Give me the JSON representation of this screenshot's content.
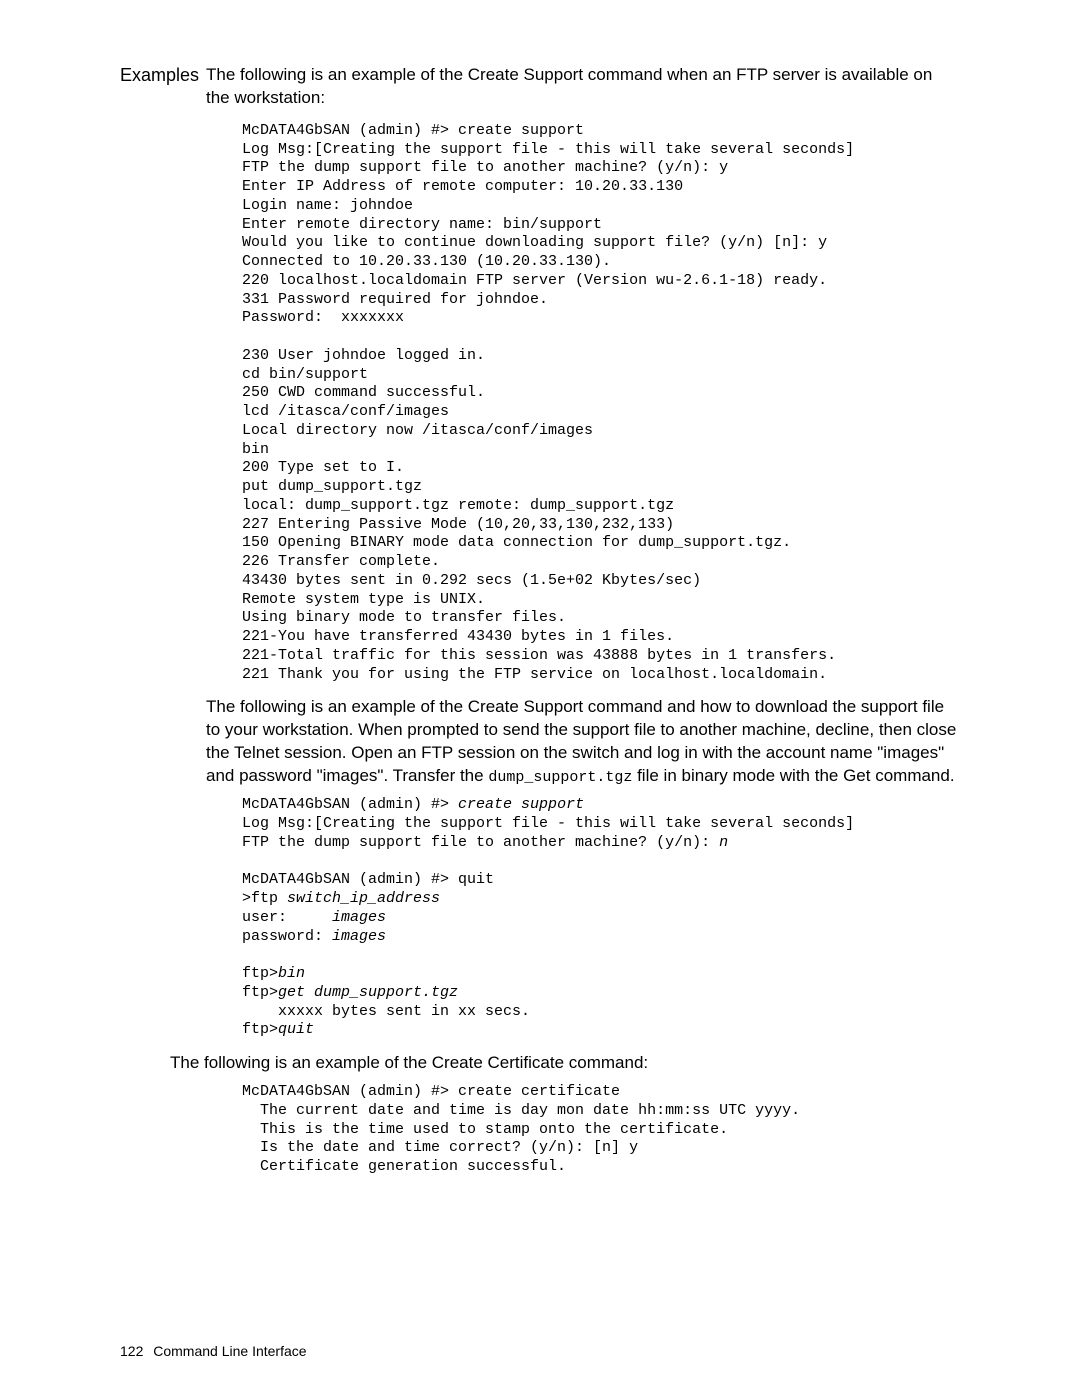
{
  "labels": {
    "examples": "Examples"
  },
  "paragraphs": {
    "intro1": "The following is an example of the Create Support command when an FTP server is available on the workstation:",
    "intro2a": "The following is an example of the Create Support command and how to download the support file to your workstation. When prompted to send the support file to another machine, decline, then close the Telnet session. Open an FTP session on the switch and log in with the account name \"images\" and password \"images\". Transfer the ",
    "intro2_code": "dump_support.tgz",
    "intro2b": " file in binary mode with the Get command.",
    "intro3": "The following is an example of the Create Certificate command:"
  },
  "code1": "McDATA4GbSAN (admin) #> create support\nLog Msg:[Creating the support file - this will take several seconds]\nFTP the dump support file to another machine? (y/n): y\nEnter IP Address of remote computer: 10.20.33.130\nLogin name: johndoe\nEnter remote directory name: bin/support\nWould you like to continue downloading support file? (y/n) [n]: y\nConnected to 10.20.33.130 (10.20.33.130).\n220 localhost.localdomain FTP server (Version wu-2.6.1-18) ready.\n331 Password required for johndoe.\nPassword:  xxxxxxx\n\n230 User johndoe logged in.\ncd bin/support\n250 CWD command successful.\nlcd /itasca/conf/images\nLocal directory now /itasca/conf/images\nbin\n200 Type set to I.\nput dump_support.tgz\nlocal: dump_support.tgz remote: dump_support.tgz\n227 Entering Passive Mode (10,20,33,130,232,133)\n150 Opening BINARY mode data connection for dump_support.tgz.\n226 Transfer complete.\n43430 bytes sent in 0.292 secs (1.5e+02 Kbytes/sec)\nRemote system type is UNIX.\nUsing binary mode to transfer files.\n221-You have transferred 43430 bytes in 1 files.\n221-Total traffic for this session was 43888 bytes in 1 transfers.\n221 Thank you for using the FTP service on localhost.localdomain.",
  "code2": {
    "l1a": "McDATA4GbSAN (admin) #> ",
    "l1b": "create support",
    "l2": "Log Msg:[Creating the support file - this will take several seconds]",
    "l3a": "FTP the dump support file to another machine? (y/n): ",
    "l3b": "n",
    "l5": "McDATA4GbSAN (admin) #> quit",
    "l6a": ">ftp ",
    "l6b": "switch_ip_address",
    "l7a": "user:     ",
    "l7b": "images",
    "l8a": "password: ",
    "l8b": "images",
    "l10a": "ftp>",
    "l10b": "bin",
    "l11a": "ftp>",
    "l11b": "get dump_support.tgz",
    "l12": "    xxxxx bytes sent in xx secs.",
    "l13a": "ftp>",
    "l13b": "quit"
  },
  "code3": "McDATA4GbSAN (admin) #> create certificate\n  The current date and time is day mon date hh:mm:ss UTC yyyy.\n  This is the time used to stamp onto the certificate.\n  Is the date and time correct? (y/n): [n] y\n  Certificate generation successful.",
  "footer": {
    "page": "122",
    "title": "Command Line Interface"
  }
}
